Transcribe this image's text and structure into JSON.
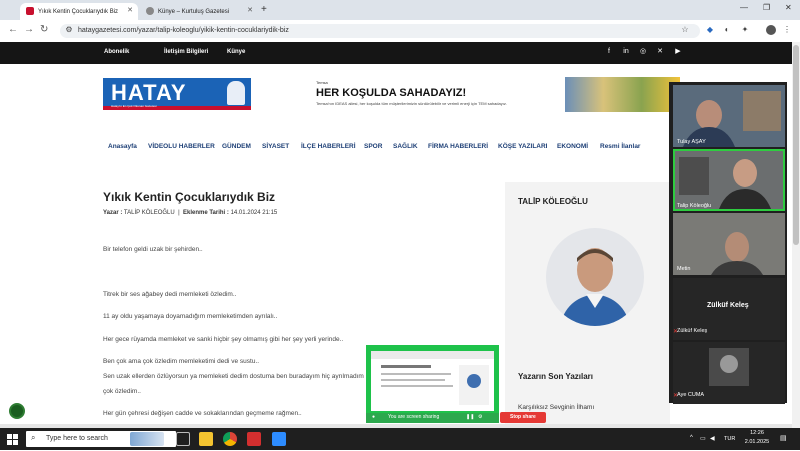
{
  "browser": {
    "tabs": [
      {
        "title": "Yıkık Kentin Çocuklarıydık Biz",
        "active": true
      },
      {
        "title": "Künye – Kurtuluş Gazetesi",
        "active": false
      }
    ],
    "new_tab": "+",
    "url": "hataygazetesi.com/yazar/talip-koleoglu/yikik-kentin-cocuklariydik-biz"
  },
  "site": {
    "top_links": [
      "Abonelik",
      "İletişim Bilgileri",
      "Künye"
    ],
    "logo_text": "HATAY",
    "logo_sub": "Hatay'ın En Çok Okunan Gazetesi",
    "ad": {
      "tag": "Temsa",
      "headline": "HER KOŞULDA SAHADAYIZ!",
      "text": "Temsa'nın IDEAS ailesi, her koşulda tüm müşterilerimizin sürdürülebilir ve verimli enerji için TEM sahadayız."
    },
    "menu": [
      "Anasayfa",
      "VİDEOLU HABERLER",
      "GÜNDEM",
      "SİYASET",
      "İLÇE HABERLERİ",
      "SPOR",
      "SAĞLIK",
      "FİRMA HABERLERİ",
      "KÖŞE YAZILARI",
      "EKONOMİ",
      "Resmi İlanlar"
    ]
  },
  "article": {
    "title": "Yıkık Kentin Çocuklarıydık Biz",
    "author_label": "Yazar :",
    "author": "TALİP KÖLEOĞLU",
    "separator": "|",
    "date_label": "Eklenme Tarihi :",
    "date": "14.01.2024 21:15",
    "paragraphs": [
      "Bir telefon geldi uzak bir şehirden..",
      "Titrek bir ses ağabey dedi memleketi özledim..",
      "11 ay oldu yaşamaya doyamadığım memleketimden ayrılalı..",
      "Her gece rüyamda memleket ve sanki hiçbir şey olmamış gibi her şey yerli yerinde..",
      "Ben çok ama çok özledim memleketimi dedi ve sustu..",
      "Sen uzak ellerden özlüyorsun ya memleketi dedim dostuma ben buradayım hiç ayrılmadım hiç..",
      "çok özledim..",
      "Her gün çehresi değişen cadde ve sokaklarından geçmeme rağmen.."
    ]
  },
  "sidebar": {
    "author_name": "TALİP KÖLEOĞLU",
    "latest_title": "Yazarın Son Yazıları",
    "latest_item": "Karşılıksız Sevginin İlhamı"
  },
  "meeting": {
    "participants": [
      "Tulay AŞAY",
      "Talip Köleoğlu",
      "Metin",
      "Zülküf Keleş",
      "Aye CUMA"
    ],
    "big_name": "Zülküf Keleş"
  },
  "share": {
    "status": "You are screen sharing",
    "stop": "Stop share"
  },
  "taskbar": {
    "search_placeholder": "Type here to search",
    "lang": "TUR",
    "time": "12:26",
    "date": "2.01.2025"
  },
  "colors": {
    "menu": "#1d3f76",
    "logo_blue": "#1b63b6",
    "share_green": "#1ec24a",
    "stop_red": "#e53935"
  }
}
